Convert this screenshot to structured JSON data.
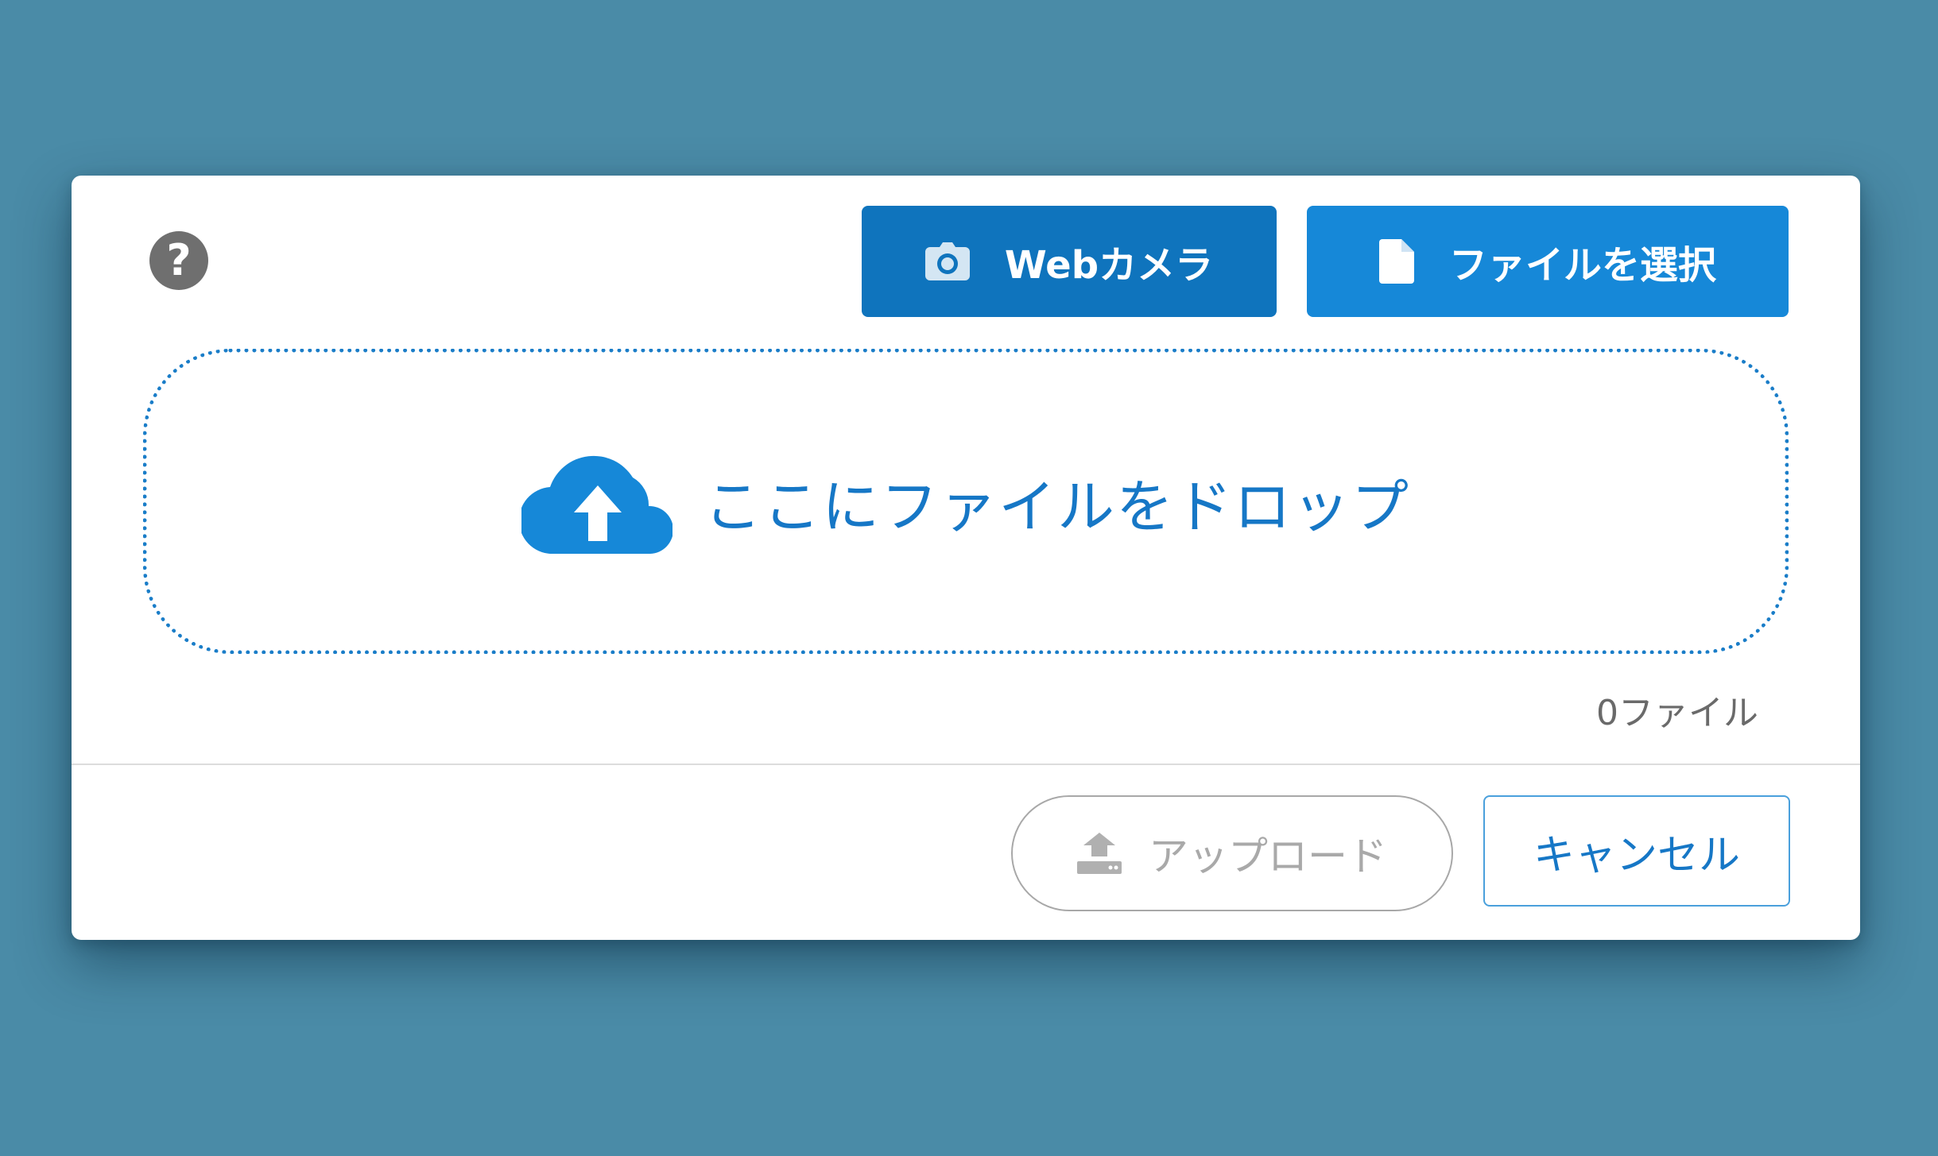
{
  "dialog": {
    "help_icon_glyph": "?",
    "webcam_button": {
      "label": "Webカメラ",
      "icon": "camera-icon"
    },
    "file_button": {
      "label": "ファイルを選択",
      "icon": "file-icon"
    },
    "dropzone": {
      "text": "ここにファイルをドロップ",
      "icon": "cloud-upload-icon"
    },
    "file_count": "0ファイル",
    "upload_button": {
      "label": "アップロード",
      "icon": "upload-icon",
      "disabled": true
    },
    "cancel_button": {
      "label": "キャンセル"
    }
  },
  "colors": {
    "background": "#4a8ba7",
    "primary_dark": "#0f74bd",
    "primary": "#1688d8",
    "accent_text": "#1677c6",
    "disabled": "#a9a9a9"
  }
}
